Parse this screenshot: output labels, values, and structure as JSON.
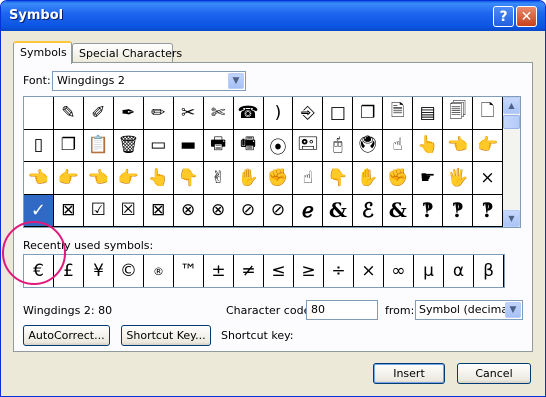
{
  "window": {
    "title": "Symbol",
    "help_label": "?",
    "close_label": "✕"
  },
  "tabs": [
    {
      "label": "Symbols",
      "active": true
    },
    {
      "label": "Special Characters",
      "active": false
    }
  ],
  "font": {
    "label": "Font:",
    "value": "Wingdings 2"
  },
  "symbol_grid": {
    "rows": [
      [
        "",
        "✎",
        "✐",
        "✒",
        "✏",
        "✂",
        "✄",
        "☎",
        ")",
        "⎆",
        "□",
        "❐",
        "🗎",
        "▤",
        "🗐",
        "🗋"
      ],
      [
        "▯",
        "❐",
        "📋",
        "🗑",
        "▭",
        "▬",
        "🖶",
        "🖷",
        "⦿",
        "🖭",
        "🖰",
        "🖲",
        "☝",
        "👆",
        "👈",
        "👉"
      ],
      [
        "👈",
        "👉",
        "👈",
        "👉",
        "👆",
        "👇",
        "✌",
        "✋",
        "✊",
        "☝",
        "👇",
        "✋",
        "✊",
        "☛",
        "🖐",
        "×"
      ],
      [
        "✓",
        "⊠",
        "☑",
        "☒",
        "⊠",
        "⊗",
        "⊗",
        "⊘",
        "⊘",
        "ℯ",
        "&",
        "ℰ",
        "&",
        "‽",
        "‽",
        "‽"
      ]
    ],
    "selected_row": 3,
    "selected_col": 0
  },
  "recently_used": {
    "label": "Recently used symbols:",
    "symbols": [
      "€",
      "£",
      "¥",
      "©",
      "®",
      "™",
      "±",
      "≠",
      "≤",
      "≥",
      "÷",
      "×",
      "∞",
      "µ",
      "α",
      "β"
    ]
  },
  "info": {
    "symbol_name": "Wingdings 2: 80",
    "char_code_label": "Character code:",
    "char_code_value": "80",
    "from_label": "from:",
    "from_value": "Symbol (decimal)",
    "shortcut_label": "Shortcut key:"
  },
  "buttons": {
    "autocorrect": "AutoCorrect...",
    "shortcut_key": "Shortcut Key...",
    "insert": "Insert",
    "cancel": "Cancel"
  },
  "colors": {
    "title_bar": "#0a55e3",
    "selection": "#316ac5",
    "highlight_ring": "#e01a7b"
  }
}
